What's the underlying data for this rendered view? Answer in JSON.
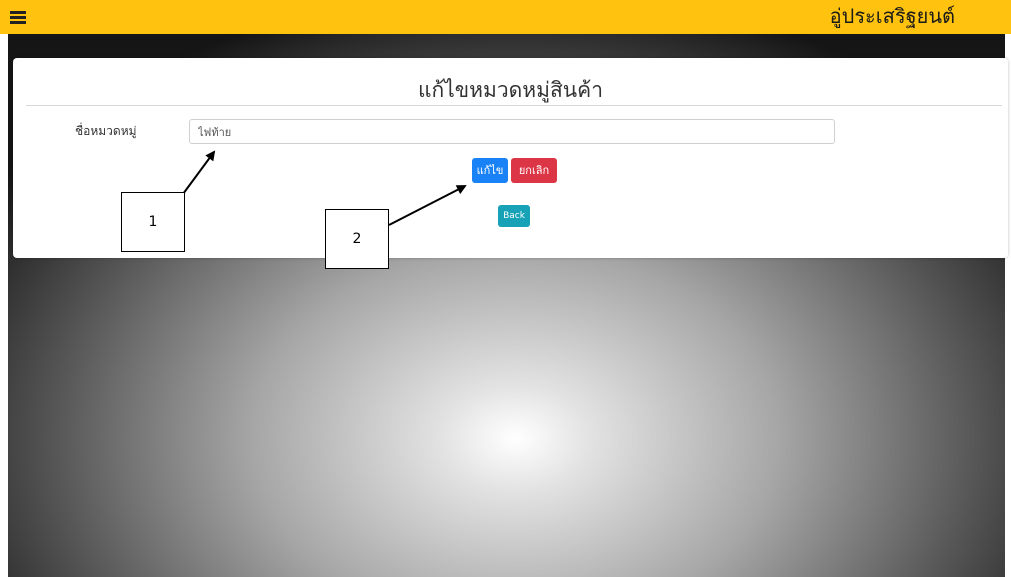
{
  "header": {
    "menu_icon": "hamburger-menu-icon",
    "brand": "อู่ประเสริฐยนต์",
    "bar_color": "#ffc20e"
  },
  "card": {
    "title": "แก้ไขหมวดหมู่สินค้า",
    "field_label": "ชื่อหมวดหมู่",
    "field_value": "ไฟท้าย",
    "edit_button": "แก้ไข",
    "cancel_button": "ยกเลิก",
    "back_button": "Back"
  },
  "colors": {
    "edit": "#1a82f7",
    "cancel": "#dc3545",
    "back": "#17a2b8"
  },
  "annotations": {
    "callout_1": "1",
    "callout_2": "2"
  }
}
